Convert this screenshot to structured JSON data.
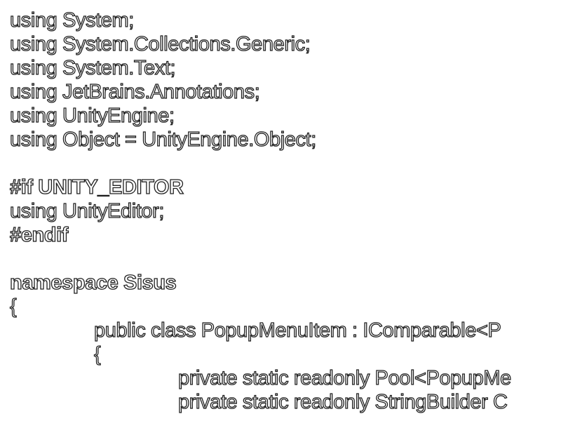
{
  "code": {
    "lines": [
      "using System;",
      "using System.Collections.Generic;",
      "using System.Text;",
      "using JetBrains.Annotations;",
      "using UnityEngine;",
      "using Object = UnityEngine.Object;",
      "",
      "#if UNITY_EDITOR",
      "using UnityEditor;",
      "#endif",
      "",
      "namespace Sisus",
      "{",
      "public class PopupMenuItem : IComparable<P",
      "{",
      "private static readonly Pool<PopupMe",
      "private static readonly StringBuilder C"
    ]
  }
}
